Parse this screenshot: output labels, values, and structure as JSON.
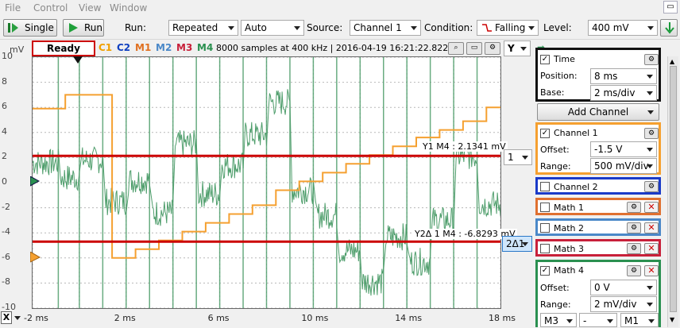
{
  "menu": [
    "File",
    "Control",
    "View",
    "Window"
  ],
  "toolbar": {
    "single_label": "Single",
    "run_label": "Run",
    "run_mode_label": "Run:",
    "run_mode": "Repeated",
    "auto": "Auto",
    "source_label": "Source:",
    "source": "Channel 1",
    "condition_label": "Condition:",
    "condition": "Falling",
    "level_label": "Level:",
    "level": "400 mV"
  },
  "plot_header": {
    "status": "Ready",
    "tags": [
      {
        "label": "C1",
        "color": "#f0a000"
      },
      {
        "label": "C2",
        "color": "#1040c0"
      },
      {
        "label": "M1",
        "color": "#e07020"
      },
      {
        "label": "M2",
        "color": "#4a88c8"
      },
      {
        "label": "M3",
        "color": "#c8203a"
      },
      {
        "label": "M4",
        "color": "#2a9050"
      }
    ],
    "info": "8000 samples at 400 kHz | 2016-04-19 16:21:22.822",
    "y_selector": "Y"
  },
  "y_unit": "mV",
  "y_ticks": [
    "10",
    "8",
    "6",
    "4",
    "2",
    "0",
    "-2",
    "-4",
    "-6",
    "-8",
    "-10"
  ],
  "x_axis_button": "X",
  "x_ticks": [
    "-2 ms",
    "2 ms",
    "6 ms",
    "10 ms",
    "14 ms",
    "18 ms"
  ],
  "cursors": {
    "y1_label": "Y1 M4 : 2.1341 mV",
    "y2_label": "Y2Δ 1 M4 : -6.8293 mV",
    "y1_tag": "1",
    "y2_tag": "2Δ1"
  },
  "chart_data": {
    "type": "line",
    "xlim": [
      -2,
      18
    ],
    "ylim": [
      -10,
      10
    ],
    "series": [
      {
        "name": "C1",
        "color": "#f5a030",
        "x": [
          -2,
          -0.6,
          -0.6,
          1.4,
          1.4,
          2.4,
          2.4,
          3.4,
          3.4,
          4.4,
          4.4,
          5.4,
          5.4,
          6.4,
          6.4,
          7.4,
          7.4,
          8.4,
          8.4,
          9.4,
          9.4,
          10.4,
          10.4,
          11.4,
          11.4,
          12.4,
          12.4,
          13.4,
          13.4,
          14.4,
          14.4,
          15.4,
          15.4,
          16.4,
          16.4,
          17.4,
          17.4,
          18
        ],
        "y": [
          5.9,
          5.9,
          7.0,
          7.0,
          -6.0,
          -6.0,
          -5.3,
          -5.3,
          -4.6,
          -4.6,
          -3.9,
          -3.9,
          -3.2,
          -3.2,
          -2.5,
          -2.5,
          -1.8,
          -1.8,
          -0.6,
          -0.6,
          0.1,
          0.1,
          0.8,
          0.8,
          1.5,
          1.5,
          2.2,
          2.2,
          2.9,
          2.9,
          3.6,
          3.6,
          4.2,
          4.2,
          4.9,
          4.9,
          6.0,
          6.0
        ]
      },
      {
        "name": "M4",
        "color": "#4f9e6c",
        "x": [
          -2,
          -0.9,
          -0.8,
          0.0,
          0.1,
          1.0,
          1.1,
          2.0,
          2.1,
          3.0,
          3.1,
          4.0,
          4.1,
          5.0,
          5.1,
          6.0,
          6.1,
          7.0,
          7.1,
          8.0,
          8.1,
          9.0,
          9.1,
          10.0,
          10.1,
          11.0,
          11.1,
          12.0,
          12.1,
          13.0,
          13.1,
          14.0,
          14.1,
          15.0,
          15.1,
          16.0,
          16.1,
          17.0,
          17.1,
          18
        ],
        "y": [
          1.6,
          1.6,
          0.4,
          0.4,
          1.8,
          1.8,
          -1.5,
          -1.5,
          0.2,
          0.2,
          -2.4,
          -2.4,
          3.1,
          3.1,
          -0.9,
          -0.9,
          1.4,
          1.4,
          3.8,
          3.8,
          6.4,
          6.4,
          -0.6,
          -0.6,
          -2.6,
          -2.6,
          -5.4,
          -5.4,
          -7.9,
          -7.9,
          -4.3,
          -4.3,
          -6.3,
          -6.3,
          -3.0,
          -3.0,
          2.1,
          2.1,
          -1.7,
          -1.7
        ]
      }
    ],
    "hlines": [
      {
        "label": "Y1 M4 : 2.1341 mV",
        "y": 2.1341,
        "color": "#cc0000"
      },
      {
        "label": "Y2Δ 1 M4 : -6.8293 mV",
        "y": -4.7,
        "color": "#cc0000"
      }
    ],
    "grid": true
  },
  "panel": {
    "time": {
      "label": "Time",
      "position_label": "Position:",
      "position": "8 ms",
      "base_label": "Base:",
      "base": "2 ms/div"
    },
    "add_channel": "Add Channel",
    "channel1": {
      "label": "Channel 1",
      "offset_label": "Offset:",
      "offset": "-1.5 V",
      "range_label": "Range:",
      "range": "500 mV/div",
      "color": "#f5a030"
    },
    "channel2": {
      "label": "Channel 2",
      "color": "#1a3ac8"
    },
    "math1": {
      "label": "Math 1",
      "color": "#e07030"
    },
    "math2": {
      "label": "Math 2",
      "color": "#4a88c8"
    },
    "math3": {
      "label": "Math 3",
      "color": "#c8203a"
    },
    "math4": {
      "label": "Math 4",
      "offset_label": "Offset:",
      "offset": "0 V",
      "range_label": "Range:",
      "range": "2 mV/div",
      "op_a": "M3",
      "op_b": "-",
      "op_c": "M1",
      "color": "#2a9050"
    }
  }
}
